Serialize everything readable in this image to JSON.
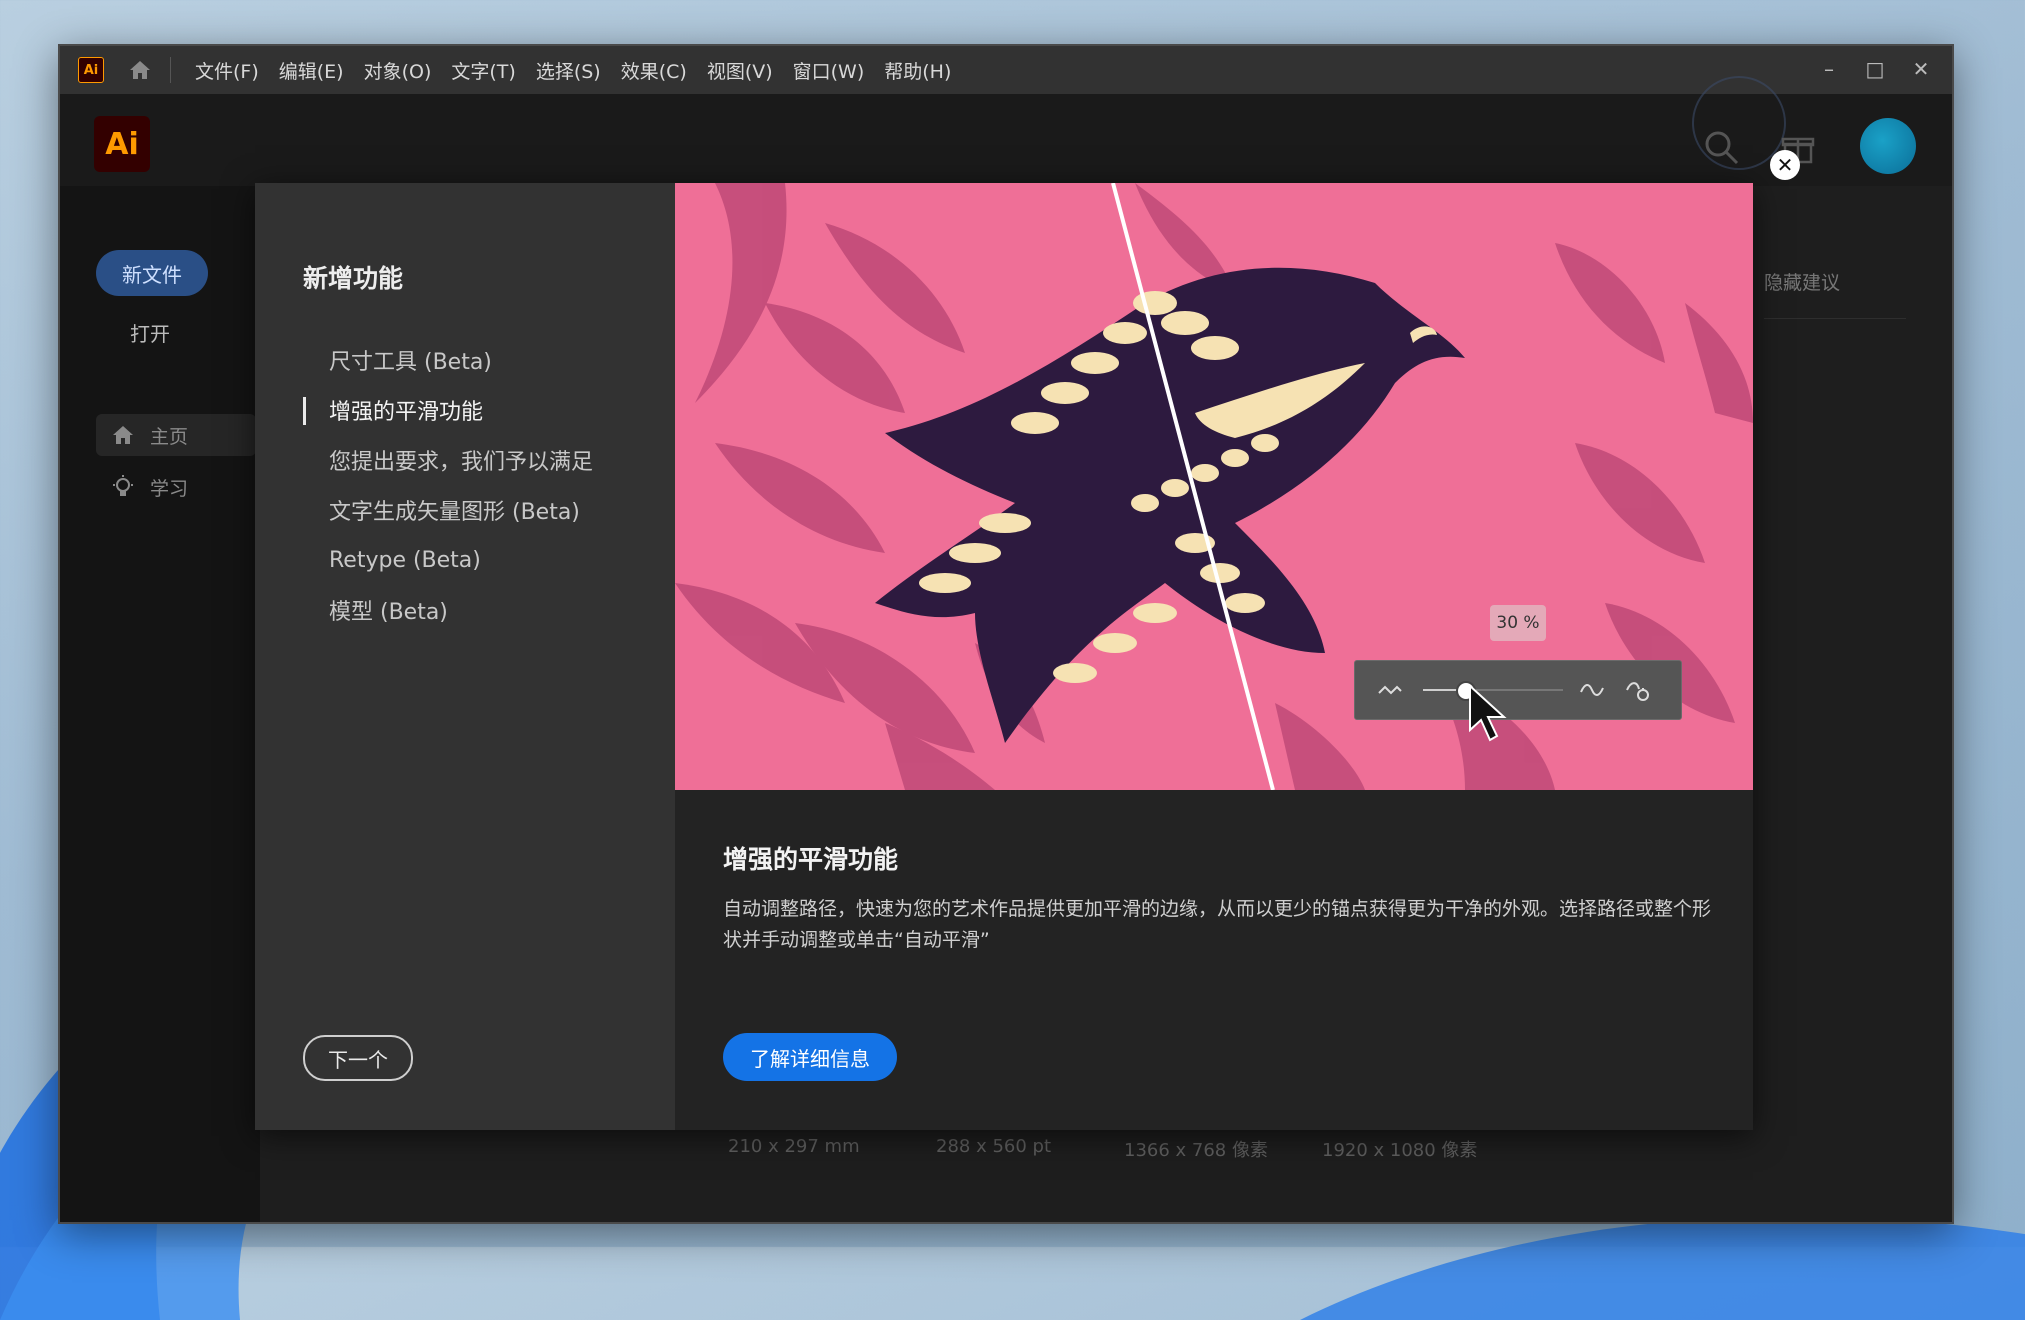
{
  "window": {
    "app_badge": "Ai",
    "menu": [
      "文件(F)",
      "编辑(E)",
      "对象(O)",
      "文字(T)",
      "选择(S)",
      "效果(C)",
      "视图(V)",
      "窗口(W)",
      "帮助(H)"
    ],
    "controls": {
      "minimize": "–",
      "maximize": "□",
      "close": "✕"
    }
  },
  "header": {
    "logo": "Ai"
  },
  "sidebar": {
    "new_file": "新文件",
    "open": "打开",
    "items": [
      {
        "label": "主页",
        "icon": "home-icon"
      },
      {
        "label": "学习",
        "icon": "lightbulb-icon"
      }
    ]
  },
  "background": {
    "hide_suggestions": "隐藏建议",
    "presets": [
      {
        "size": "210 x 297 mm"
      },
      {
        "size": "288 x 560 pt"
      },
      {
        "size": "1366 x 768 像素"
      },
      {
        "size": "1920 x 1080 像素"
      }
    ]
  },
  "dialog": {
    "heading": "新增功能",
    "features": [
      "尺寸工具 (Beta)",
      "增强的平滑功能",
      "您提出要求，我们予以满足",
      "文字生成矢量图形 (Beta)",
      "Retype (Beta)",
      "模型 (Beta)"
    ],
    "active_feature": 1,
    "next_button": "下一个",
    "feature_title": "增强的平滑功能",
    "feature_description": "自动调整路径，快速为您的艺术作品提供更加平滑的边缘，从而以更少的锚点获得更为干净的外观。选择路径或整个形状并手动调整或单击“自动平滑”",
    "learn_more": "了解详细信息",
    "close": "✕",
    "hero": {
      "smoothing_percent_label": "30 %",
      "smoothing_value": 0.3,
      "colors": {
        "background": "#ef6f97",
        "leaves": "#c24b79",
        "bird": "#2d1a3f",
        "feathers": "#f6e2b3"
      }
    }
  },
  "colors": {
    "accent": "#1473e6",
    "new_file_button": "#2a4f86",
    "app_orange": "#ff9a00"
  }
}
